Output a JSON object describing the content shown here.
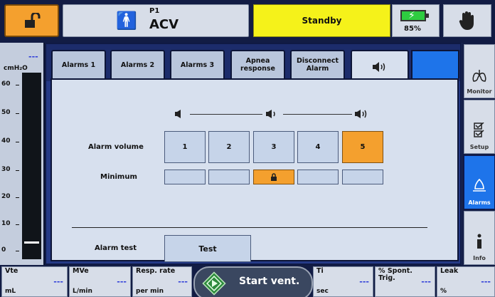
{
  "header": {
    "patient_label": "P1",
    "mode": "ACV",
    "status": "Standby",
    "battery_pct": "85%"
  },
  "gauge": {
    "value": "---",
    "unit": "cmH₂O",
    "ticks": [
      "60",
      "50",
      "40",
      "30",
      "20",
      "10",
      "0"
    ],
    "marker_value": 3
  },
  "tabs": [
    {
      "label": "Alarms 1"
    },
    {
      "label": "Alarms 2"
    },
    {
      "label": "Alarms 3"
    },
    {
      "label": "Apnea response"
    },
    {
      "label": "Disconnect Alarm"
    }
  ],
  "alarm_volume": {
    "label": "Alarm volume",
    "levels": [
      "1",
      "2",
      "3",
      "4",
      "5"
    ],
    "selected": "5"
  },
  "minimum": {
    "label": "Minimum",
    "locked_level": "3"
  },
  "alarm_test": {
    "label": "Alarm test",
    "button": "Test"
  },
  "sidebar": [
    {
      "label": "Monitor",
      "icon": "lungs-icon"
    },
    {
      "label": "Setup",
      "icon": "checklist-icon"
    },
    {
      "label": "Alarms",
      "icon": "bell-icon",
      "active": true
    },
    {
      "label": "Info",
      "icon": "info-icon"
    }
  ],
  "bottom": {
    "vte": {
      "name": "Vte",
      "unit": "mL",
      "value": "---"
    },
    "mve": {
      "name": "MVe",
      "unit": "L/min",
      "value": "---"
    },
    "resp_rate": {
      "name": "Resp. rate",
      "unit": "per min",
      "value": "---"
    },
    "start_label": "Start vent.",
    "ti": {
      "name": "Ti",
      "unit": "sec",
      "value": "---"
    },
    "spont": {
      "name": "% Spont. Trig.",
      "unit": "",
      "value": "---"
    },
    "leak": {
      "name": "Leak",
      "unit": "%",
      "value": "---"
    }
  },
  "colors": {
    "accent_orange": "#f4a02e",
    "status_yellow": "#f5f21a",
    "active_blue": "#1e74ea",
    "panel_navy": "#253a86"
  }
}
